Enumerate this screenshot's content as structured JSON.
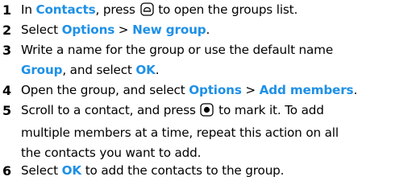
{
  "steps": [
    {
      "num": "1",
      "parts": [
        {
          "t": "In "
        },
        {
          "t": "Contacts",
          "kw": true
        },
        {
          "t": ", press "
        },
        {
          "key": "contacts-key-icon"
        },
        {
          "t": " to open the groups list."
        }
      ]
    },
    {
      "num": "2",
      "parts": [
        {
          "t": "Select "
        },
        {
          "t": "Options",
          "kw": true
        },
        {
          "t": " > "
        },
        {
          "t": "New group",
          "kw": true
        },
        {
          "t": "."
        }
      ]
    },
    {
      "num": "3",
      "lines": [
        [
          {
            "t": "Write a name for the group or use the default name"
          }
        ],
        [
          {
            "t": "Group",
            "kw": true
          },
          {
            "t": ", and select "
          },
          {
            "t": "OK",
            "kw": true
          },
          {
            "t": "."
          }
        ]
      ]
    },
    {
      "num": "4",
      "parts": [
        {
          "t": "Open the group, and select "
        },
        {
          "t": "Options",
          "kw": true
        },
        {
          "t": " > "
        },
        {
          "t": "Add members",
          "kw": true
        },
        {
          "t": "."
        }
      ]
    },
    {
      "num": "5",
      "lines": [
        [
          {
            "t": "Scroll to a contact, and press "
          },
          {
            "key": "select-key-icon"
          },
          {
            "t": " to mark it. To add"
          }
        ],
        [
          {
            "t": "multiple members at a time, repeat this action on all"
          }
        ],
        [
          {
            "t": "the contacts you want to add."
          }
        ]
      ]
    },
    {
      "num": "6",
      "parts": [
        {
          "t": "Select "
        },
        {
          "t": "OK",
          "kw": true
        },
        {
          "t": " to add the contacts to the group."
        }
      ]
    }
  ]
}
